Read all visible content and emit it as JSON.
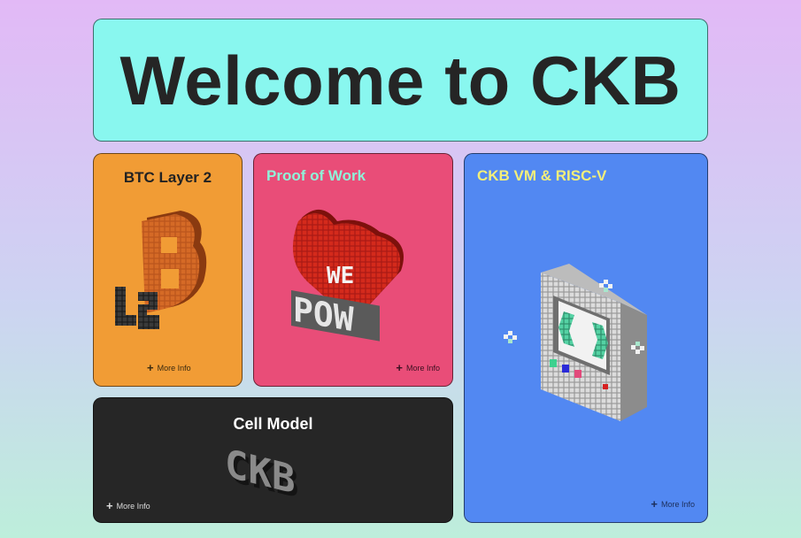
{
  "hero": {
    "title": "Welcome to CKB"
  },
  "cards": {
    "btc": {
      "title": "BTC Layer 2",
      "more": "More Info",
      "art_icon": "l2-btc-icon"
    },
    "pow": {
      "title": "Proof of Work",
      "more": "More Info",
      "art_icon": "heart-we-pow-icon",
      "art_text_top": "WE",
      "art_text_bottom": "POW"
    },
    "vm": {
      "title": "CKB VM & RISC-V",
      "more": "More Info",
      "art_icon": "computer-icon"
    },
    "cell": {
      "title": "Cell Model",
      "more": "More Info",
      "art_icon": "ckb-blocks-icon",
      "art_text": "CKB"
    }
  },
  "colors": {
    "hero_bg": "#89f7ef",
    "btc_bg": "#f19c35",
    "pow_bg": "#e94d78",
    "vm_bg": "#5288f2",
    "cell_bg": "#262626"
  }
}
